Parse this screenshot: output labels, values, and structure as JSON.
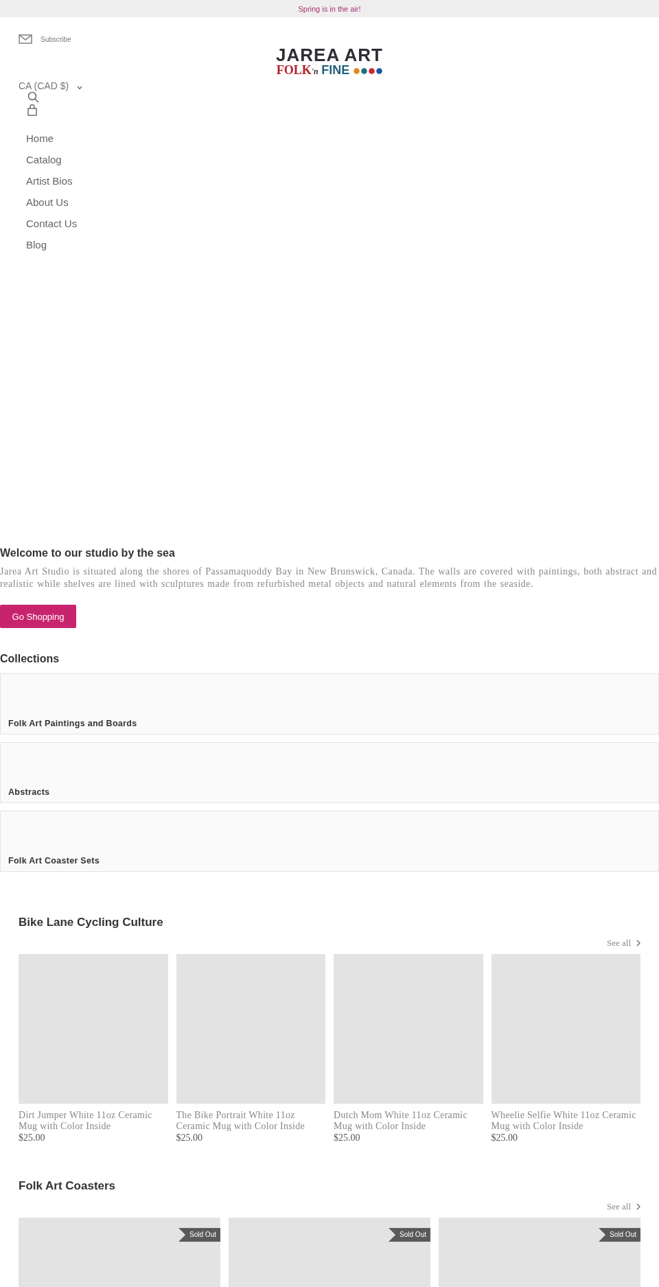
{
  "announcement": "Spring is in the air!",
  "header": {
    "subscribe": "Subscribe",
    "logo": {
      "line1": "JAREA ART",
      "line2a": "FOLK",
      "line2b": "'n",
      "line2c": "FINE"
    },
    "currency": "CA (CAD $)"
  },
  "nav": [
    "Home",
    "Catalog",
    "Artist Bios",
    "About Us",
    "Contact Us",
    "Blog"
  ],
  "welcome": {
    "title": "Welcome to our studio by the sea",
    "text": "Jarea Art Studio is situated along the shores of Passamaquoddy Bay in New Brunswick, Canada. The walls are covered with paintings, both abstract and realistic while shelves are lined with sculptures made from refurbished metal objects and natural elements from the seaside.",
    "button": "Go Shopping"
  },
  "collections": {
    "title": "Collections",
    "items": [
      "Folk Art Paintings and Boards",
      "Abstracts",
      "Folk Art Coaster Sets"
    ]
  },
  "sections": [
    {
      "title": "Bike Lane Cycling Culture",
      "see_all": "See all",
      "products": [
        {
          "name": "Dirt Jumper White 11oz Ceramic Mug with Color Inside",
          "price": "$25.00",
          "sold_out": false
        },
        {
          "name": "The Bike Portrait White 11oz Ceramic Mug with Color Inside",
          "price": "$25.00",
          "sold_out": false
        },
        {
          "name": "Dutch Mom White 11oz Ceramic Mug with Color Inside",
          "price": "$25.00",
          "sold_out": false
        },
        {
          "name": "Wheelie Selfie White 11oz Ceramic Mug with Color Inside",
          "price": "$25.00",
          "sold_out": false
        }
      ]
    },
    {
      "title": "Folk Art Coasters",
      "see_all": "See all",
      "products": [
        {
          "badge": "Sold Out",
          "sold_out": true
        },
        {
          "badge": "Sold Out",
          "sold_out": true
        },
        {
          "badge": "Sold Out",
          "sold_out": true
        }
      ]
    }
  ]
}
